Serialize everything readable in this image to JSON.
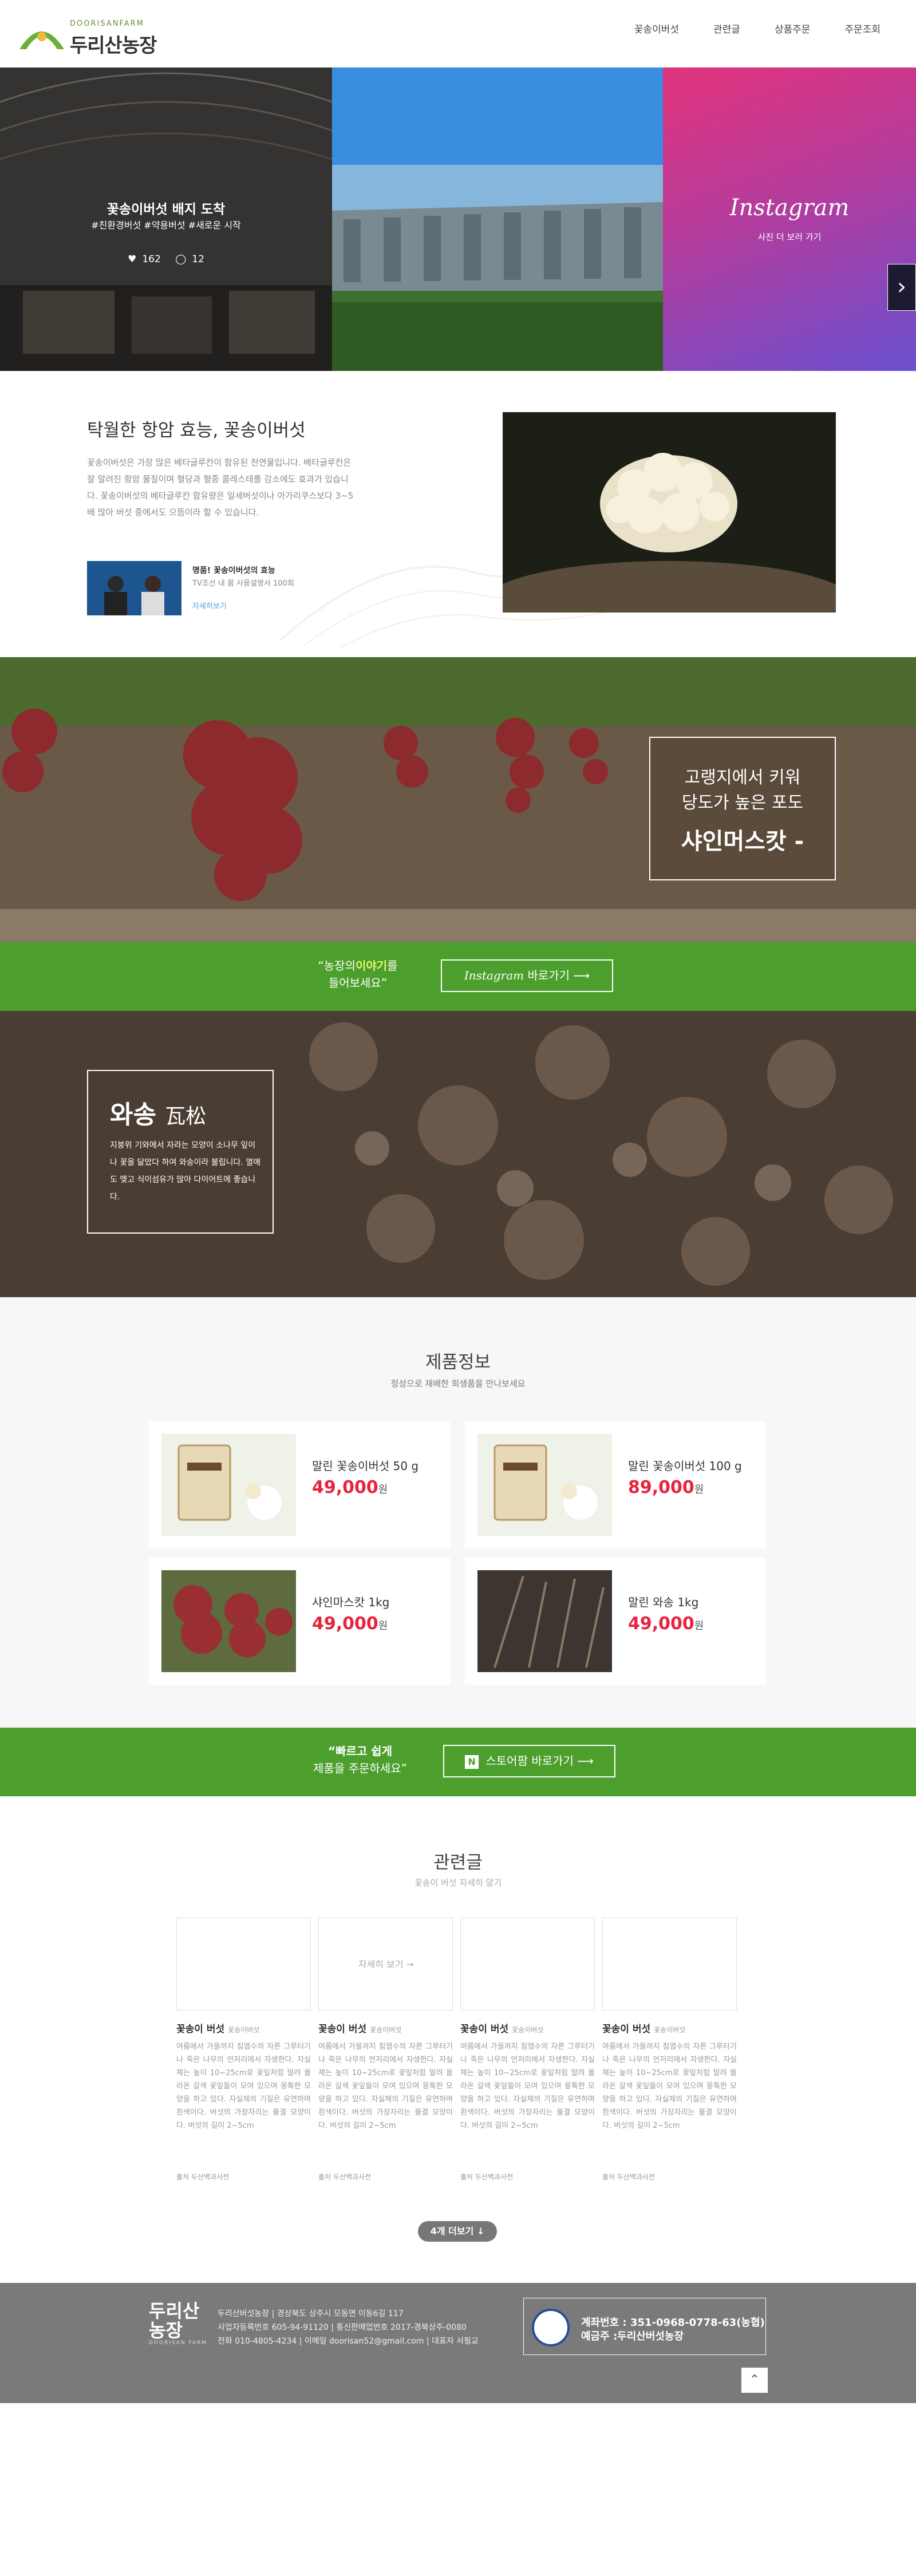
{
  "header": {
    "logo_en": "DOORISANFARM",
    "logo_ko": "두리산농장",
    "nav": [
      "꽃송이버섯",
      "관련글",
      "상품주문",
      "주문조회"
    ]
  },
  "banner": {
    "post_title": "꽃송이버섯 배지 도착",
    "post_tags": "#친환경버섯 #약용버섯 #새로운 시작",
    "likes": "162",
    "comments": "12",
    "instagram_title": "Instagram",
    "instagram_sub": "사진 더 보러 가기"
  },
  "intro": {
    "title": "탁월한 항암 효능, 꽃송이버섯",
    "body": "꽃송이버섯은 가장 많은 베타글루칸이 함유된 천연물입니다. 베타글루칸은 잘 알려진 항암 물질이며 혈당과 혈중 콜레스테롤 감소에도 효과가 있습니다. 꽃송이버섯의 베타글루칸 함유량은 일세버섯이나 아가리쿠스보다 3~5배 많아 버섯 중에서도 으뜸이라 할 수 있습니다.",
    "tv_caption": "명품! 꽃송이버섯의 효능",
    "tv_caption2": "TV조선 내 몸 사용설명서 100회",
    "tv_more": "자세히보기"
  },
  "grape": {
    "line1": "고랭지에서 키워",
    "line2": "당도가 높은 포도",
    "line3": "샤인머스캇 -"
  },
  "green1": {
    "quote_a": "“농장의",
    "quote_em": "이야기",
    "quote_b": "를",
    "quote_c": "들어보세요”",
    "button_ig": "Instagram",
    "button_text": "바로가기"
  },
  "wasong": {
    "title": "와송",
    "title_han": "瓦松",
    "body": "지붕위 기와에서 자라는 모양이 소나무 잎이나 꽃을 닮았다 하여 와송이라 불립니다. 열매도 맺고 식이섬유가 많아 다이어트에 좋습니다."
  },
  "products": {
    "title": "제품정보",
    "subtitle": "정성으로 재배한 희생품을 만나보세요",
    "currency": "원",
    "items": [
      {
        "name": "말린 꽃송이버섯 50 g",
        "price": "49,000"
      },
      {
        "name": "말린 꽃송이버섯 100 g",
        "price": "89,000"
      },
      {
        "name": "샤인마스캇 1kg",
        "price": "49,000"
      },
      {
        "name": "말린 와송 1kg",
        "price": "49,000"
      }
    ]
  },
  "green2": {
    "quote_em": "“빠르고 쉽게",
    "quote_c": "제품을 주문하세요”",
    "button_n": "N",
    "button_text": "스토어팜 바로가기"
  },
  "related": {
    "title": "관련글",
    "subtitle": "꽃송이 버섯 자세히 알기",
    "hover_text": "자세히 보기 →",
    "items": [
      {
        "title": "꽃송이 버섯",
        "meta": "꽃송이버섯",
        "body": "여름에서 가을까지 침엽수의 자른 그루터기나 죽은 나무의 언저리에서 자생한다. 자실체는 높이 10~25cm로 꽃잎처럼 말려 올라온 갈색 꽃잎들이 모여 있으며 뭉툭한 모양을 하고 있다. 자실체의 기질은 유연하며 흰색이다. 버섯의 가장자리는 물결 모양이다. 버섯의 길이 2~5cm",
        "source": "출처 두산백과사전"
      },
      {
        "title": "꽃송이 버섯",
        "meta": "꽃송이버섯",
        "body": "여름에서 가을까지 침엽수의 자른 그루터기나 죽은 나무의 언저리에서 자생한다. 자실체는 높이 10~25cm로 꽃잎처럼 말려 올라온 갈색 꽃잎들이 모여 있으며 뭉툭한 모양을 하고 있다. 자실체의 기질은 유연하며 흰색이다. 버섯의 가장자리는 물결 모양이다. 버섯의 길이 2~5cm",
        "source": "출처 두산백과사전"
      },
      {
        "title": "꽃송이 버섯",
        "meta": "꽃송이버섯",
        "body": "여름에서 가을까지 침엽수의 자른 그루터기나 죽은 나무의 언저리에서 자생한다. 자실체는 높이 10~25cm로 꽃잎처럼 말려 올라온 갈색 꽃잎들이 모여 있으며 뭉툭한 모양을 하고 있다. 자실체의 기질은 유연하며 흰색이다. 버섯의 가장자리는 물결 모양이다. 버섯의 길이 2~5cm",
        "source": "출처 두산백과사전"
      },
      {
        "title": "꽃송이 버섯",
        "meta": "꽃송이버섯",
        "body": "여름에서 가을까지 침엽수의 자른 그루터기나 죽은 나무의 언저리에서 자생한다. 자실체는 높이 10~25cm로 꽃잎처럼 말려 올라온 갈색 꽃잎들이 모여 있으며 뭉툭한 모양을 하고 있다. 자실체의 기질은 유연하며 흰색이다. 버섯의 가장자리는 물결 모양이다. 버섯의 길이 2~5cm",
        "source": "출처 두산백과사전"
      }
    ],
    "more_button": "4개 더보기 ↓"
  },
  "footer": {
    "logo_line1": "두리산",
    "logo_line2": "농장",
    "logo_en": "DOORISAN FARM",
    "info1": "두리산버섯농장 | 경상북도 상주시 모동면 이동6길 117",
    "info2": "사업자등록번호 605-94-91120 | 통신판매업번호 2017-경북상주-0080",
    "info3": "전화 010-4805-4234 | 이메일 doorisan52@gmail.com | 대표자 서필교",
    "bank1": "계좌번호 : 351-0968-0778-63(농협)",
    "bank2": "예금주 :두리산버섯농장",
    "top_button": "⌃"
  },
  "colors": {
    "green": "#4c9f2d",
    "price": "#e8233e",
    "instagram_start": "#e2337c",
    "instagram_end": "#6a4fcf"
  }
}
